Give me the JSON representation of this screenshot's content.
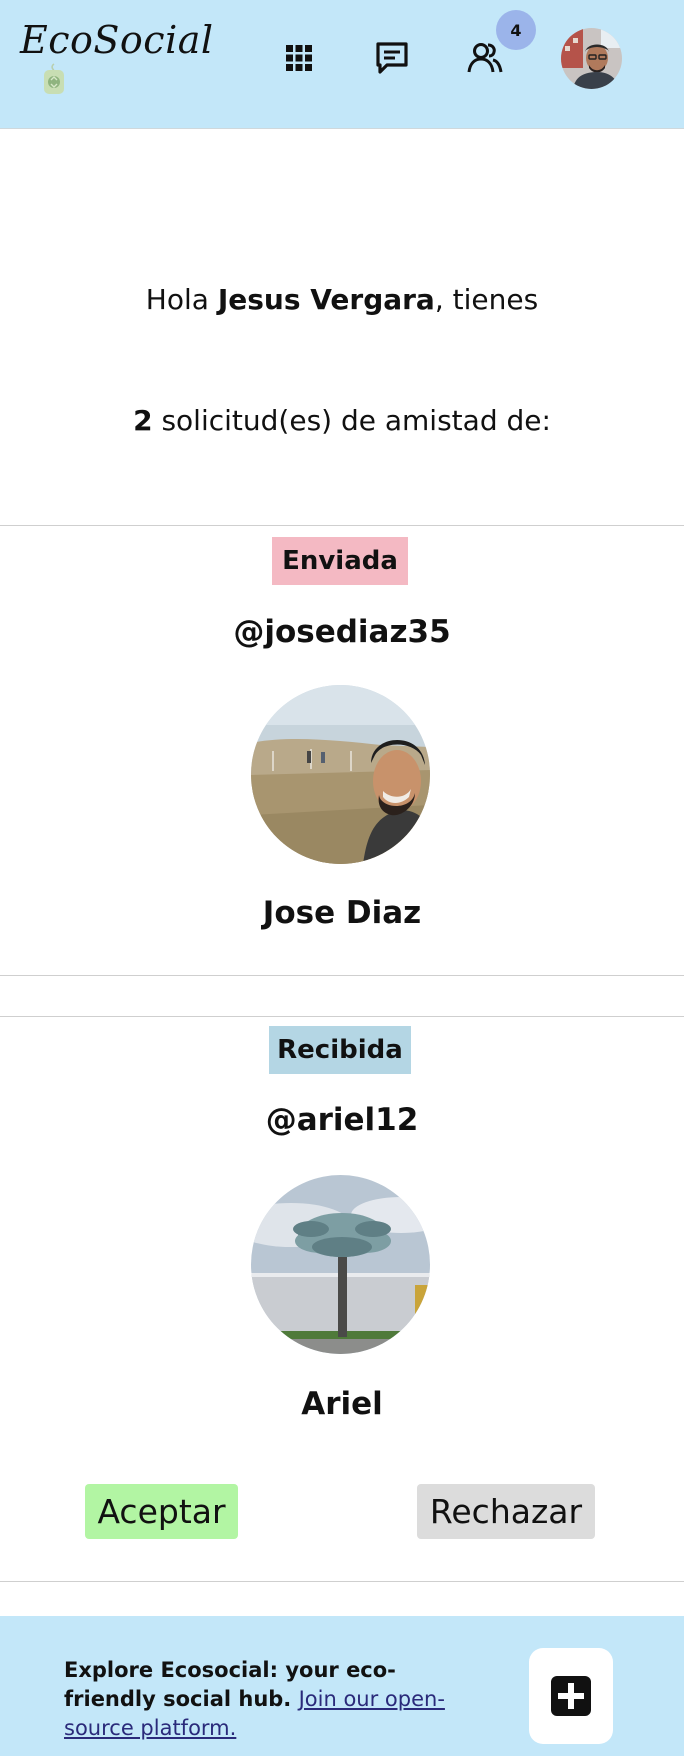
{
  "header": {
    "logo_text": "EcoSocial",
    "nav": {
      "grid_icon": "grid-icon",
      "chat_icon": "chat-icon",
      "friends_icon": "friends-icon",
      "notification_count": "4"
    },
    "colors": {
      "header_bg": "#c3e7f9",
      "badge_bg": "#9bb4ea"
    }
  },
  "greeting": {
    "prefix": "Hola ",
    "user_name": "Jesus Vergara",
    "suffix": ", tienes"
  },
  "requests_summary": {
    "count": "2",
    "text": " solicitud(es) de amistad de:"
  },
  "requests": [
    {
      "status": "Enviada",
      "status_color": "#f4b9c3",
      "username": "@josediaz35",
      "name": "Jose Diaz"
    },
    {
      "status": "Recibida",
      "status_color": "#b4d6e4",
      "username": "@ariel12",
      "name": "Ariel",
      "accept_label": "Aceptar",
      "accept_color": "#b2f5a3",
      "reject_label": "Rechazar",
      "reject_color": "#dcdcdc"
    }
  ],
  "footer": {
    "text": "Explore Ecosocial: your eco-friendly social hub.",
    "link_text": "Join our open-source platform.",
    "add_icon": "plus-square-icon"
  }
}
